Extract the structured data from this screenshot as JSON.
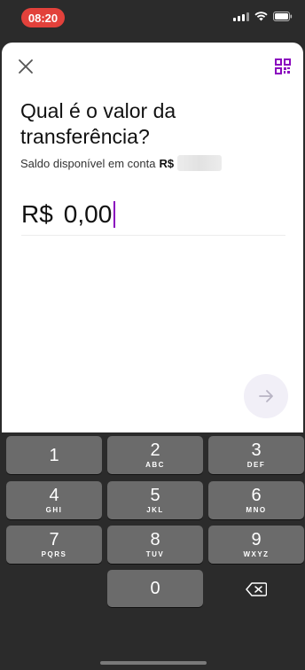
{
  "status_bar": {
    "time": "08:20"
  },
  "header": {
    "close_icon": "close-icon",
    "qr_icon": "qr-code-icon"
  },
  "main": {
    "title": "Qual é o valor da transferência?",
    "balance_label": "Saldo disponível em conta",
    "balance_currency": "R$",
    "amount_currency": "R$",
    "amount_value": "0,00"
  },
  "colors": {
    "accent": "#8a05be",
    "time_pill": "#e2413b",
    "key_bg": "#6b6b6b",
    "keyboard_bg": "#2b2b2b"
  },
  "keyboard": {
    "keys": [
      {
        "digit": "1",
        "letters": ""
      },
      {
        "digit": "2",
        "letters": "ABC"
      },
      {
        "digit": "3",
        "letters": "DEF"
      },
      {
        "digit": "4",
        "letters": "GHI"
      },
      {
        "digit": "5",
        "letters": "JKL"
      },
      {
        "digit": "6",
        "letters": "MNO"
      },
      {
        "digit": "7",
        "letters": "PQRS"
      },
      {
        "digit": "8",
        "letters": "TUV"
      },
      {
        "digit": "9",
        "letters": "WXYZ"
      },
      {
        "digit": "0",
        "letters": ""
      }
    ],
    "delete_icon": "backspace-icon"
  }
}
